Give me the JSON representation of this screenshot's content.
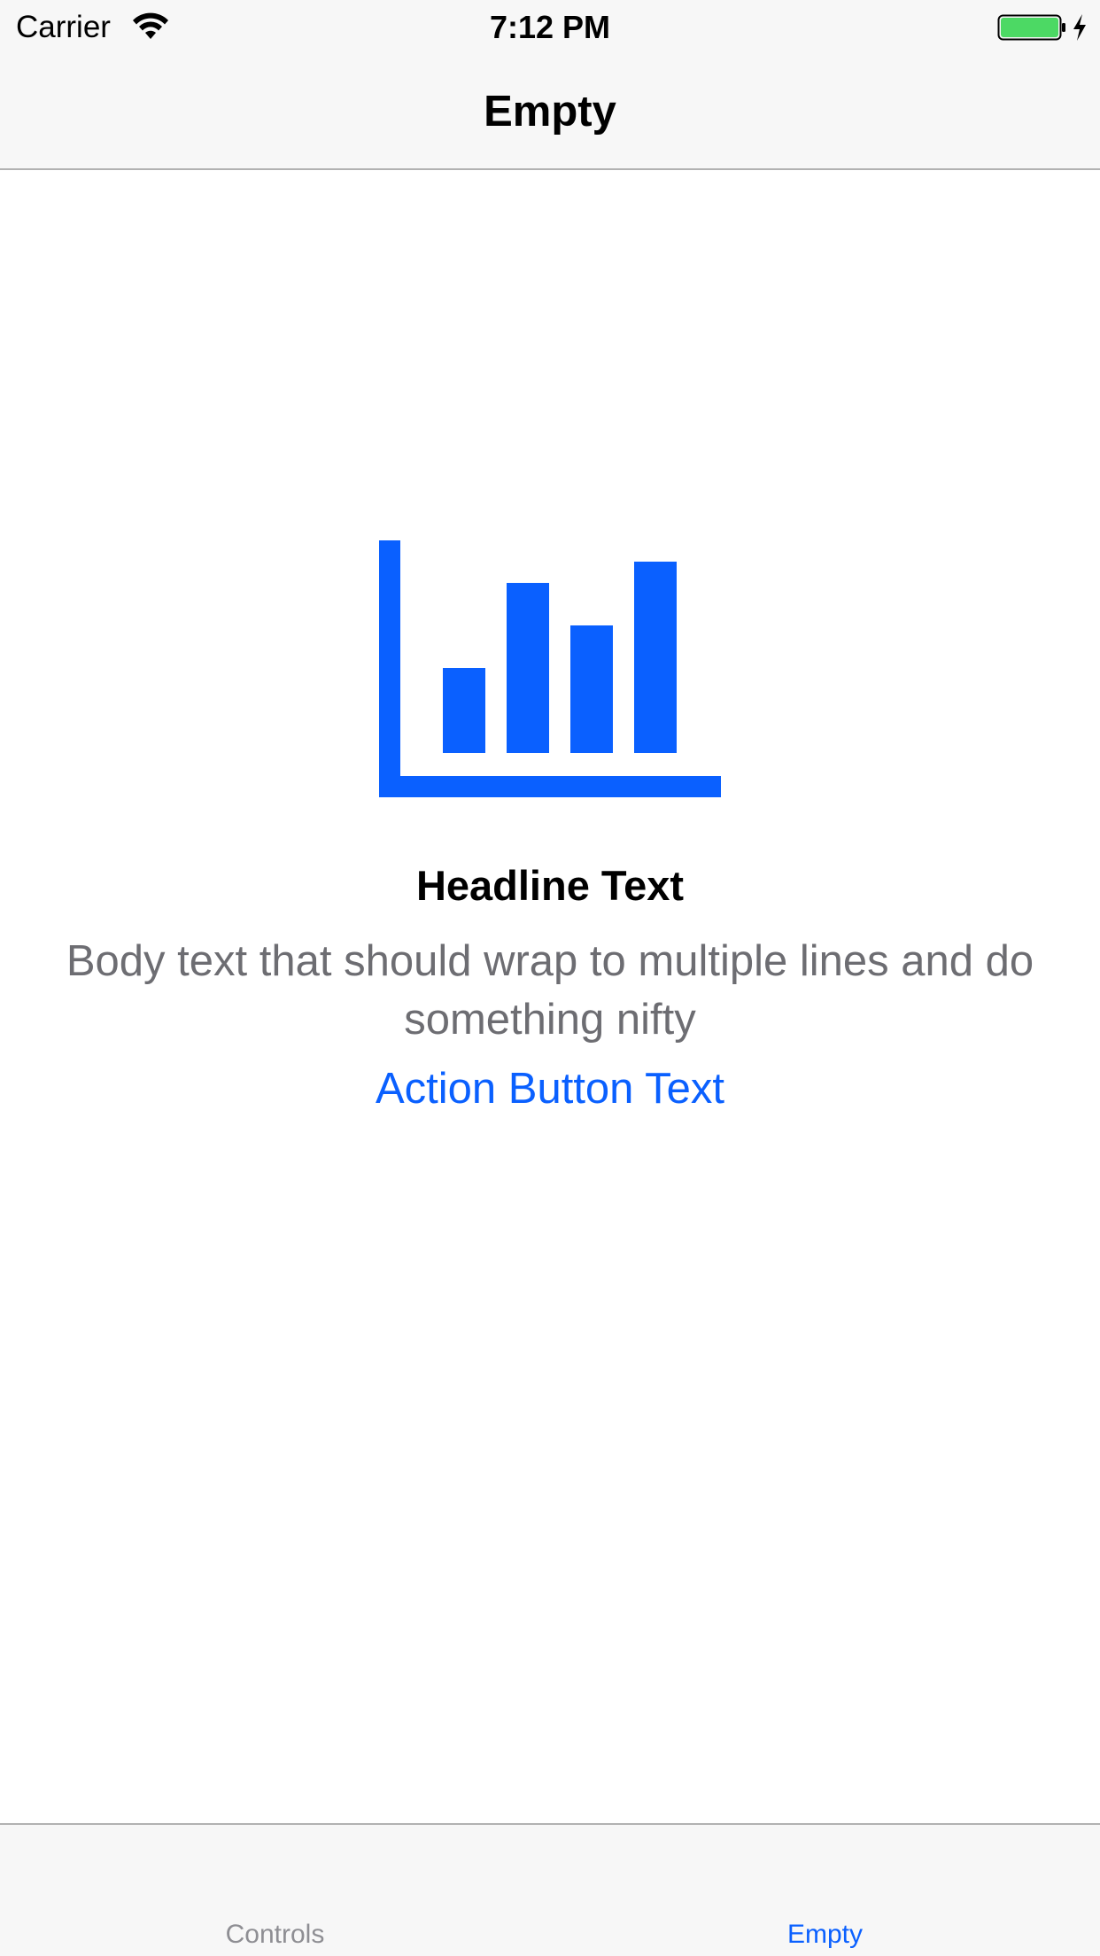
{
  "status_bar": {
    "carrier": "Carrier",
    "time": "7:12 PM",
    "wifi_icon": "wifi-icon",
    "battery_icon": "battery-icon",
    "charging_icon": "charging-bolt-icon",
    "battery_level": 1.0,
    "battery_color": "#4cd964"
  },
  "nav_bar": {
    "title": "Empty"
  },
  "empty_state": {
    "icon": "bar-chart-icon",
    "icon_color": "#0a60ff",
    "headline": "Headline Text",
    "body": "Body text that should wrap to multiple lines and do something nifty",
    "action_label": "Action Button Text"
  },
  "tab_bar": {
    "tabs": [
      {
        "label": "Controls",
        "selected": false
      },
      {
        "label": "Empty",
        "selected": true
      }
    ],
    "selected_color": "#0a60ff",
    "unselected_color": "#8e8e93"
  }
}
